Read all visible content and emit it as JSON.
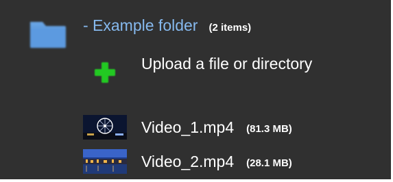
{
  "folder": {
    "title": "- Example folder",
    "count": "(2 items)",
    "icon": "folder-icon",
    "icon_color": "#4f8fd6"
  },
  "upload": {
    "label": "Upload a file or directory",
    "icon": "plus-icon",
    "icon_color": "#22c922"
  },
  "files": [
    {
      "name": "Video_1.mp4",
      "size": "(81.3 MB)",
      "thumbnail": "ferris-wheel-night-thumbnail"
    },
    {
      "name": "Video_2.mp4",
      "size": "(28.1 MB)",
      "thumbnail": "harbor-night-thumbnail"
    }
  ],
  "colors": {
    "background": "#303030",
    "link": "#86b9ee",
    "text": "#ffffff"
  }
}
